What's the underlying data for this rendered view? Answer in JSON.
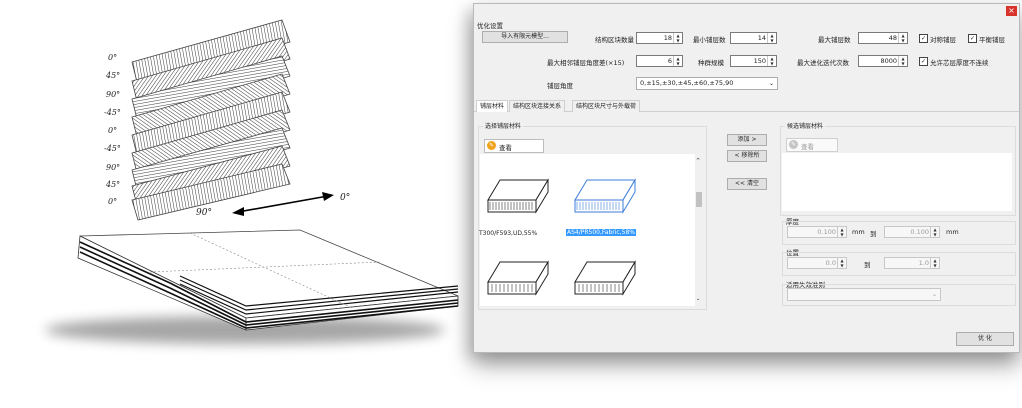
{
  "figure": {
    "ply_angles": [
      "0°",
      "45°",
      "90°",
      "-45°",
      "0°",
      "-45°",
      "90°",
      "45°",
      "0°"
    ],
    "dir_90": "90°",
    "dir_0": "0°"
  },
  "window": {
    "close_label": "×",
    "section_title": "优化设置",
    "import_button": "导入有限元模型...",
    "block_count_label": "结构区块数量",
    "block_count_value": "18",
    "min_plies_label": "最小铺层数",
    "min_plies_value": "14",
    "max_plies_label": "最大铺层数",
    "max_plies_value": "48",
    "symmetric_label": "对称铺层",
    "balanced_label": "平衡铺层",
    "max_same_angle_label": "最大相邻铺层角度差(×15)",
    "max_same_angle_value": "6",
    "population_label": "种群规模",
    "population_value": "150",
    "max_iter_label": "最大进化迭代次数",
    "max_iter_value": "8000",
    "allow_core_label": "允许芯层厚度不连续",
    "ply_angle_label": "铺层角度",
    "ply_angle_value": "0,±15,±30,±45,±60,±75,90",
    "tabs": [
      "铺层材料",
      "结构区块连接关系",
      "结构区块尺寸与外载荷"
    ],
    "select_materials_label": "选择铺层材料",
    "view_button": "查看",
    "materials": [
      "T300/F593,UD,55%",
      "AS4/PR500,Fabric,58%"
    ],
    "add_button": "添加 >",
    "remove_button": "< 移除所",
    "clear_button": "<< 清空",
    "candidate_label": "候选铺层材料",
    "view_button2": "查看",
    "thickness_label": "厚度",
    "thickness_from": "0.100",
    "thickness_unit1": "mm",
    "to_label1": "到",
    "thickness_to": "0.100",
    "thickness_unit2": "mm",
    "position_label": "位置",
    "position_from": "0.0",
    "to_label2": "到",
    "position_to": "1.0",
    "failure_label": "适用失效准则",
    "optimize_button": "优 化"
  }
}
